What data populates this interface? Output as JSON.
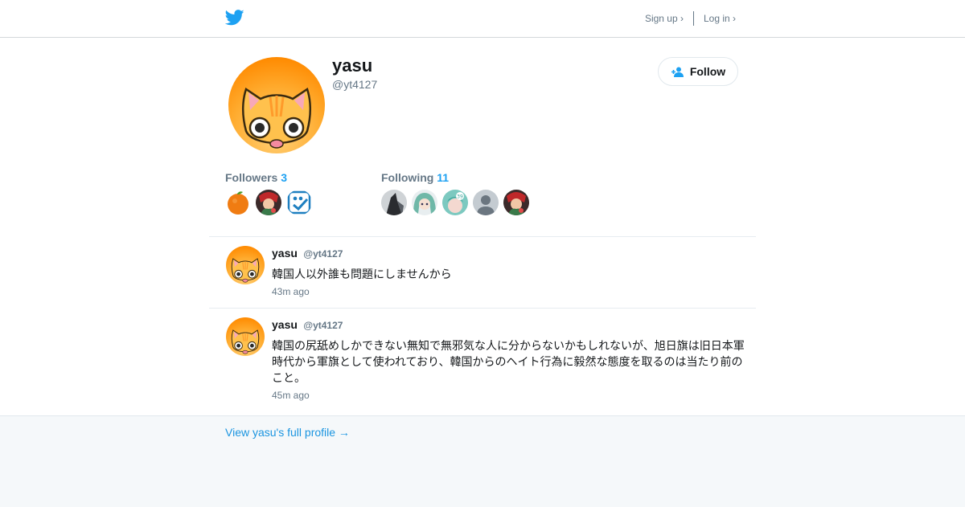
{
  "header": {
    "logo_icon": "twitter-bird-icon",
    "signup_label": "Sign up ›",
    "login_label": "Log in ›"
  },
  "profile": {
    "display_name": "yasu",
    "handle": "@yt4127",
    "avatar_icon": "orange-cat-avatar",
    "follow_label": "Follow",
    "followers_label": "Followers",
    "followers_count": "3",
    "following_label": "Following",
    "following_count": "11",
    "followers_avatars": [
      "orange-fruit-avatar",
      "red-character-avatar",
      "blue-smile-avatar"
    ],
    "following_avatars": [
      "dark-photo-avatar",
      "anime-green-hair-avatar",
      "anime-teal-avatar",
      "default-user-avatar",
      "red-character-avatar"
    ]
  },
  "tweets": [
    {
      "name": "yasu",
      "handle": "@yt4127",
      "text": "韓国人以外誰も問題にしませんから",
      "time": "43m ago"
    },
    {
      "name": "yasu",
      "handle": "@yt4127",
      "text": "韓国の尻舐めしかできない無知で無邪気な人に分からないかもしれないが、旭日旗は旧日本軍時代から軍旗として使われており、韓国からのヘイト行為に毅然な態度を取るのは当たり前のこと。",
      "time": "45m ago"
    }
  ],
  "footer": {
    "full_profile_label": "View yasu's full profile →"
  },
  "colors": {
    "accent": "#1da1f2",
    "link": "#1b95e0",
    "muted": "#657786",
    "footer_bg": "#f5f8fa"
  }
}
